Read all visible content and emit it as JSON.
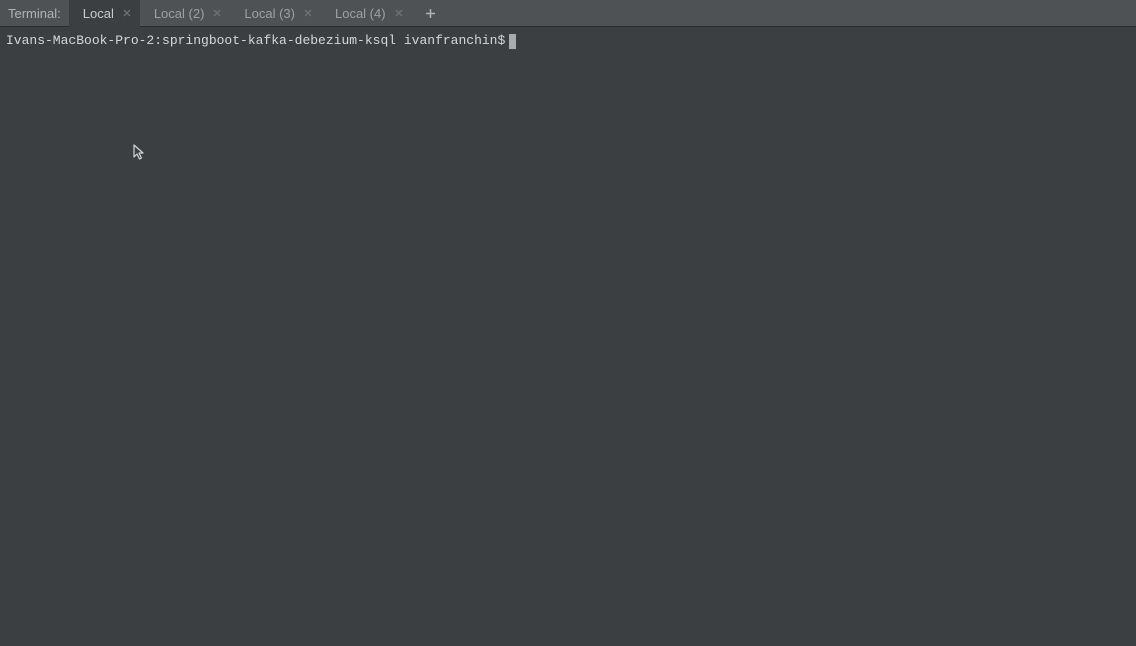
{
  "header": {
    "terminal_label": "Terminal:"
  },
  "tabs": [
    {
      "label": "Local",
      "active": true
    },
    {
      "label": "Local (2)",
      "active": false
    },
    {
      "label": "Local (3)",
      "active": false
    },
    {
      "label": "Local (4)",
      "active": false
    }
  ],
  "terminal": {
    "prompt": "Ivans-MacBook-Pro-2:springboot-kafka-debezium-ksql ivanfranchin$"
  }
}
